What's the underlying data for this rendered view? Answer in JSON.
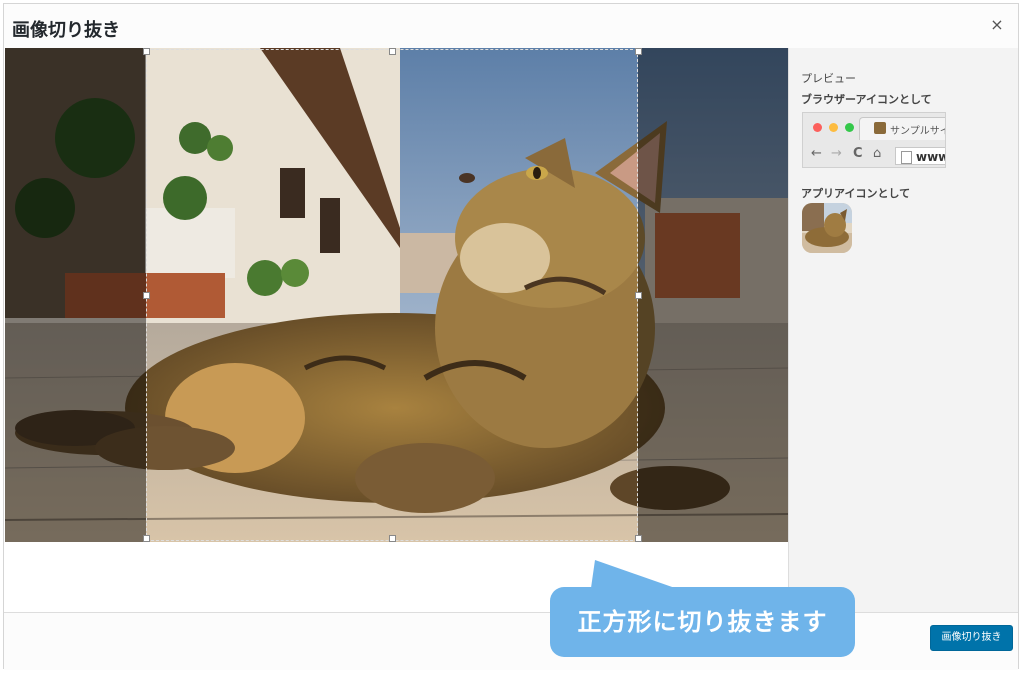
{
  "dialog": {
    "title": "画像切り抜き",
    "close_icon": "×"
  },
  "sidebar": {
    "preview_heading": "プレビュー",
    "browser_heading": "ブラウザーアイコンとして",
    "browser": {
      "tab_title": "サンプルサイ",
      "url_text": "www.",
      "nav_back": "←",
      "nav_forward": "→",
      "nav_reload": "C",
      "nav_home": "⌂"
    },
    "app_heading": "アプリアイコンとして"
  },
  "footer": {
    "crop_button_label": "画像切り抜き"
  },
  "callout": {
    "text": "正方形に切り抜きます"
  },
  "colors": {
    "primary_button": "#0073aa",
    "callout": "#6fb4ea",
    "traffic_red": "#fc605c",
    "traffic_yellow": "#fdbc40",
    "traffic_green": "#34c84a"
  }
}
